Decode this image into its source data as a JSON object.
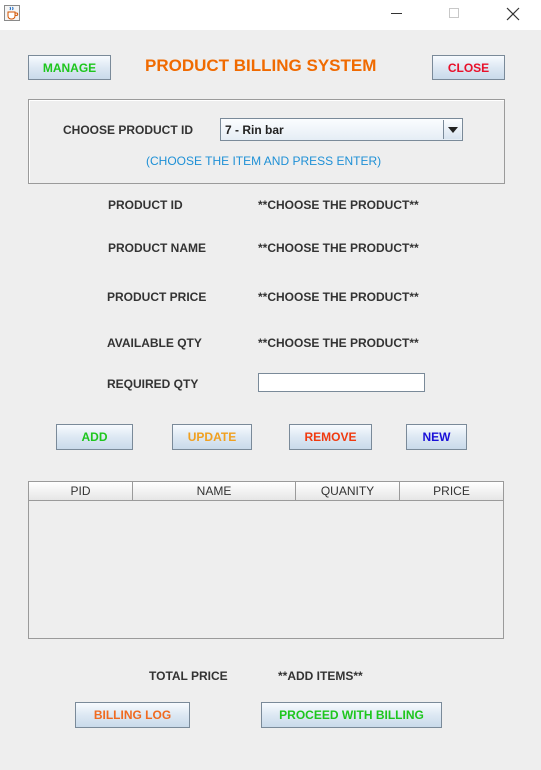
{
  "window": {
    "icon": "java-cup-icon"
  },
  "header": {
    "manage_label": "MANAGE",
    "title": "PRODUCT BILLING SYSTEM",
    "close_label": "CLOSE"
  },
  "selector": {
    "label": "CHOOSE PRODUCT ID",
    "selected": "7 - Rin bar",
    "hint": "(CHOOSE THE ITEM AND PRESS ENTER)"
  },
  "details": {
    "product_id_label": "PRODUCT ID",
    "product_id_value": "**CHOOSE THE PRODUCT**",
    "product_name_label": "PRODUCT NAME",
    "product_name_value": "**CHOOSE THE PRODUCT**",
    "product_price_label": "PRODUCT PRICE",
    "product_price_value": "**CHOOSE THE PRODUCT**",
    "available_qty_label": "AVAILABLE QTY",
    "available_qty_value": "**CHOOSE THE PRODUCT**",
    "required_qty_label": "REQUIRED QTY",
    "required_qty_value": ""
  },
  "actions": {
    "add": "ADD",
    "update": "UPDATE",
    "remove": "REMOVE",
    "new": "NEW"
  },
  "table": {
    "columns": [
      "PID",
      "NAME",
      "QUANITY",
      "PRICE"
    ],
    "rows": []
  },
  "totals": {
    "label": "TOTAL PRICE",
    "value": "**ADD ITEMS**"
  },
  "footer": {
    "billing_log": "BILLING LOG",
    "proceed": "PROCEED WITH BILLING"
  }
}
